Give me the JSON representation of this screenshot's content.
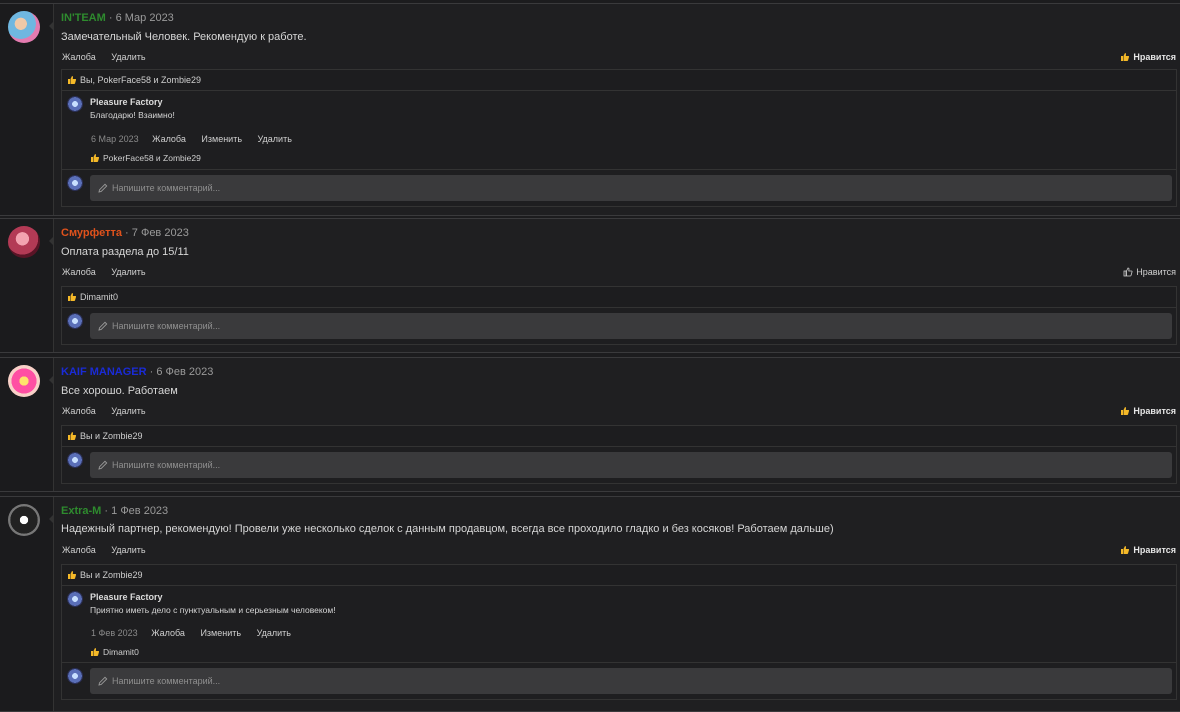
{
  "posts": [
    {
      "author": "IN'TEAM",
      "author_color": "#2e8b2e",
      "date": "6 Мар 2023",
      "text": "Замечательный Человек. Рекомендую к работе.",
      "actions": [
        "Жалоба",
        "Удалить"
      ],
      "like_label": "Нравится",
      "liked": true,
      "likes_text": "Вы, PokerFace58 и Zombie29",
      "reply": {
        "author": "Pleasure Factory",
        "text": "Благодарю! Взаимно!",
        "date": "6 Мар 2023",
        "actions": [
          "Жалоба",
          "Изменить",
          "Удалить"
        ],
        "likes_text": "PokerFace58 и Zombie29"
      },
      "comment_placeholder": "Напишите комментарий..."
    },
    {
      "author": "Смурфетта",
      "author_color": "#e0521c",
      "date": "7 Фев 2023",
      "text": "Оплата раздела до 15/11",
      "actions": [
        "Жалоба",
        "Удалить"
      ],
      "like_label": "Нравится",
      "liked": false,
      "likes_text": "Dimamit0",
      "comment_placeholder": "Напишите комментарий..."
    },
    {
      "author": "KAIF MANAGER",
      "author_color": "#1a2bd6",
      "date": "6 Фев 2023",
      "text": "Все хорошо. Работаем",
      "actions": [
        "Жалоба",
        "Удалить"
      ],
      "like_label": "Нравится",
      "liked": true,
      "likes_text": "Вы и Zombie29",
      "comment_placeholder": "Напишите комментарий..."
    },
    {
      "author": "Extra-M",
      "author_color": "#2e8b2e",
      "date": "1 Фев 2023",
      "text": "Надежный партнер, рекомендую! Провели уже несколько сделок с данным продавцом, всегда все проходило гладко и без косяков! Работаем дальше)",
      "actions": [
        "Жалоба",
        "Удалить"
      ],
      "like_label": "Нравится",
      "liked": true,
      "likes_text": "Вы и Zombie29",
      "reply": {
        "author": "Pleasure Factory",
        "text": "Приятно иметь дело с пунктуальным и серьезным человеком!",
        "date": "1 Фев 2023",
        "actions": [
          "Жалоба",
          "Изменить",
          "Удалить"
        ],
        "likes_text": "Dimamit0"
      },
      "comment_placeholder": "Напишите комментарий..."
    }
  ],
  "separator": "·",
  "icons": {
    "like": "thumbs-up-icon",
    "like_outline": "thumbs-up-outline-icon",
    "pencil": "pencil-icon"
  },
  "colors": {
    "background": "#1c1c1e",
    "input_bg": "#3a3a3c",
    "like_thumb": "#f5b928"
  }
}
